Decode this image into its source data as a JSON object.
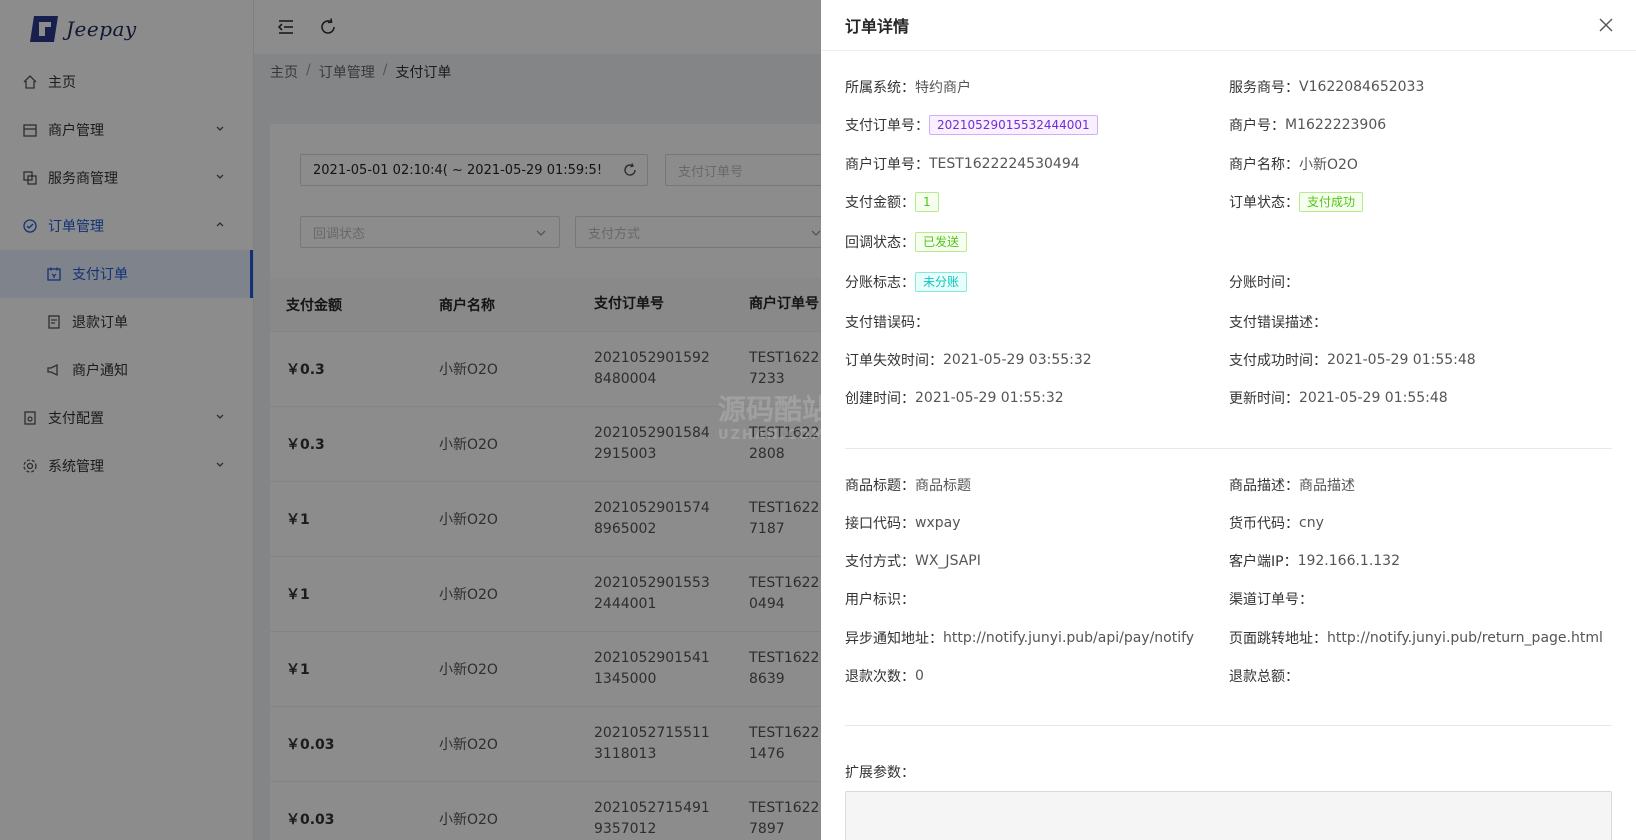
{
  "app": {
    "logo_text": "Jeepay"
  },
  "sidebar": {
    "items": [
      {
        "label": "主页",
        "icon": "home-icon"
      },
      {
        "label": "商户管理",
        "icon": "shop-icon"
      },
      {
        "label": "服务商管理",
        "icon": "partner-icon"
      },
      {
        "label": "订单管理",
        "icon": "order-icon"
      },
      {
        "label": "支付订单",
        "icon": "pay-order-icon"
      },
      {
        "label": "退款订单",
        "icon": "refund-icon"
      },
      {
        "label": "商户通知",
        "icon": "notify-icon"
      },
      {
        "label": "支付配置",
        "icon": "pay-config-icon"
      },
      {
        "label": "系统管理",
        "icon": "settings-icon"
      }
    ]
  },
  "breadcrumb": {
    "home": "主页",
    "section": "订单管理",
    "current": "支付订单"
  },
  "filters": {
    "date_range": "2021-05-01 02:10:4( ~ 2021-05-29 01:59:5!",
    "pay_order_placeholder": "支付订单号",
    "notify_status_placeholder": "回调状态",
    "pay_way_placeholder": "支付方式"
  },
  "table": {
    "headers": [
      "支付金额",
      "商户名称",
      "支付订单号",
      "商户订单号"
    ],
    "rows": [
      {
        "amount": "￥0.3",
        "mch": "小新O2O",
        "order_l1": "2021052901592",
        "order_l2": "8480004",
        "mch_l1": "TEST1622",
        "mch_l2": "7233"
      },
      {
        "amount": "￥0.3",
        "mch": "小新O2O",
        "order_l1": "2021052901584",
        "order_l2": "2915003",
        "mch_l1": "TEST1622",
        "mch_l2": "2808"
      },
      {
        "amount": "￥1",
        "mch": "小新O2O",
        "order_l1": "2021052901574",
        "order_l2": "8965002",
        "mch_l1": "TEST1622",
        "mch_l2": "7187"
      },
      {
        "amount": "￥1",
        "mch": "小新O2O",
        "order_l1": "2021052901553",
        "order_l2": "2444001",
        "mch_l1": "TEST1622",
        "mch_l2": "0494"
      },
      {
        "amount": "￥1",
        "mch": "小新O2O",
        "order_l1": "2021052901541",
        "order_l2": "1345000",
        "mch_l1": "TEST1622",
        "mch_l2": "8639"
      },
      {
        "amount": "￥0.03",
        "mch": "小新O2O",
        "order_l1": "2021052715511",
        "order_l2": "3118013",
        "mch_l1": "TEST1622",
        "mch_l2": "1476"
      },
      {
        "amount": "￥0.03",
        "mch": "小新O2O",
        "order_l1": "2021052715491",
        "order_l2": "9357012",
        "mch_l1": "TEST1622",
        "mch_l2": "7897"
      }
    ]
  },
  "drawer": {
    "title": "订单详情",
    "fields": {
      "system_label": "所属系统：",
      "system": "特约商户",
      "isv_label": "服务商号：",
      "isv": "V1622084652033",
      "pay_order_label": "支付订单号：",
      "pay_order": "20210529015532444001",
      "mch_no_label": "商户号：",
      "mch_no": "M1622223906",
      "mch_order_label": "商户订单号：",
      "mch_order": "TEST1622224530494",
      "mch_name_label": "商户名称：",
      "mch_name": "小新O2O",
      "amount_label": "支付金额：",
      "amount": "1",
      "state_label": "订单状态：",
      "state": "支付成功",
      "notify_label": "回调状态：",
      "notify": "已发送",
      "division_label": "分账标志：",
      "division": "未分账",
      "division_time_label": "分账时间：",
      "err_code_label": "支付错误码：",
      "err_msg_label": "支付错误描述：",
      "expire_label": "订单失效时间：",
      "expire": "2021-05-29 03:55:32",
      "success_label": "支付成功时间：",
      "success": "2021-05-29 01:55:48",
      "created_label": "创建时间：",
      "created": "2021-05-29 01:55:32",
      "updated_label": "更新时间：",
      "updated": "2021-05-29 01:55:48",
      "subject_label": "商品标题：",
      "subject": "商品标题",
      "body_label": "商品描述：",
      "body": "商品描述",
      "if_code_label": "接口代码：",
      "if_code": "wxpay",
      "currency_label": "货币代码：",
      "currency": "cny",
      "way_label": "支付方式：",
      "way": "WX_JSAPI",
      "ip_label": "客户端IP：",
      "ip": "192.166.1.132",
      "user_label": "用户标识：",
      "channel_order_label": "渠道订单号：",
      "notify_url_label": "异步通知地址：",
      "notify_url": "http://notify.junyi.pub/api/pay/notify",
      "return_url_label": "页面跳转地址：",
      "return_url": "http://notify.junyi.pub/return_page.html",
      "refund_times_label": "退款次数：",
      "refund_times": "0",
      "refund_amount_label": "退款总额：",
      "ext_label": "扩展参数："
    }
  },
  "colors": {
    "primary": "#1f5bd8",
    "mask": "rgba(0,0,0,0.45)"
  }
}
